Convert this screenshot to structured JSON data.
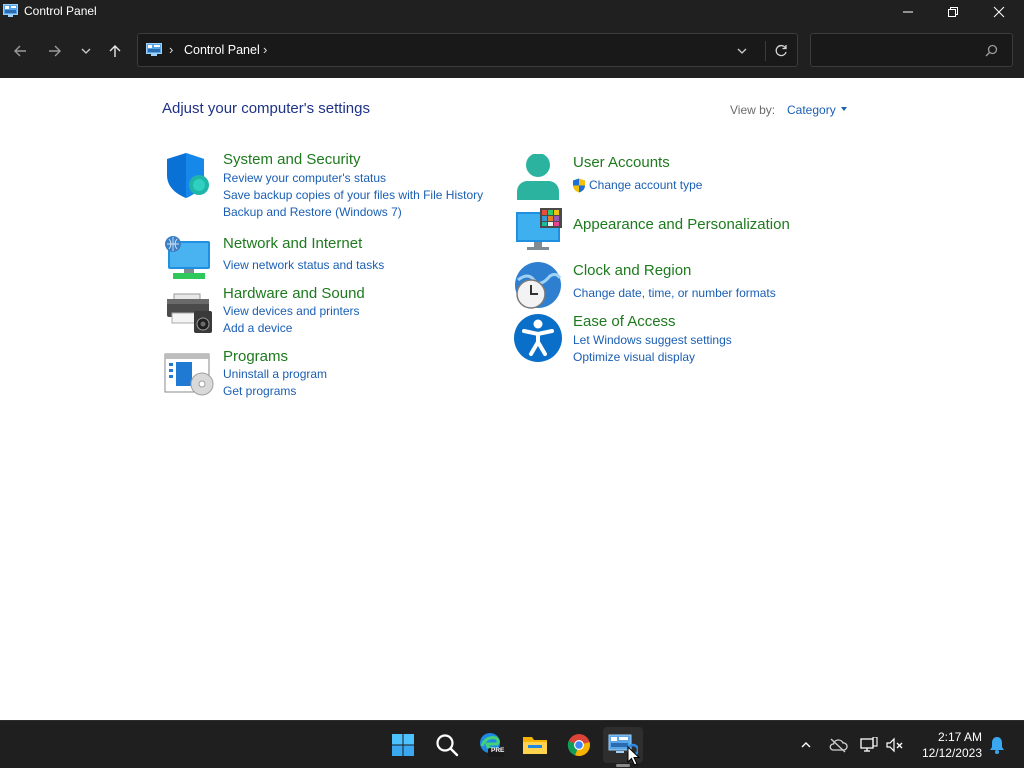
{
  "window": {
    "title": "Control Panel"
  },
  "address_bar": {
    "breadcrumb": "Control Panel",
    "separator": "›"
  },
  "search": {
    "placeholder": "",
    "value": ""
  },
  "content": {
    "heading": "Adjust your computer's settings",
    "view_by_label": "View by:",
    "view_by_value": "Category"
  },
  "categories": {
    "system_security": {
      "title": "System and Security",
      "links": [
        "Review your computer's status",
        "Save backup copies of your files with File History",
        "Backup and Restore (Windows 7)"
      ]
    },
    "network_internet": {
      "title": "Network and Internet",
      "links": [
        "View network status and tasks"
      ]
    },
    "hardware_sound": {
      "title": "Hardware and Sound",
      "links": [
        "View devices and printers",
        "Add a device"
      ]
    },
    "programs": {
      "title": "Programs",
      "links": [
        "Uninstall a program",
        "Get programs"
      ]
    },
    "user_accounts": {
      "title": "User Accounts",
      "links": [
        "Change account type"
      ]
    },
    "appearance": {
      "title": "Appearance and Personalization",
      "links": []
    },
    "clock_region": {
      "title": "Clock and Region",
      "links": [
        "Change date, time, or number formats"
      ]
    },
    "ease_of_access": {
      "title": "Ease of Access",
      "links": [
        "Let Windows suggest settings",
        "Optimize visual display"
      ]
    }
  },
  "taskbar": {
    "icons": [
      "start-icon",
      "search-icon",
      "edge-pre-icon",
      "file-explorer-icon",
      "chrome-icon",
      "control-panel-icon"
    ],
    "edge_badge": "PRE",
    "clock_time": "2:17 AM",
    "clock_date": "12/12/2023"
  },
  "colors": {
    "chrome_bg": "#202020",
    "link": "#1a5fb4",
    "category_title": "#1e7a1e",
    "heading": "#1e3287"
  }
}
